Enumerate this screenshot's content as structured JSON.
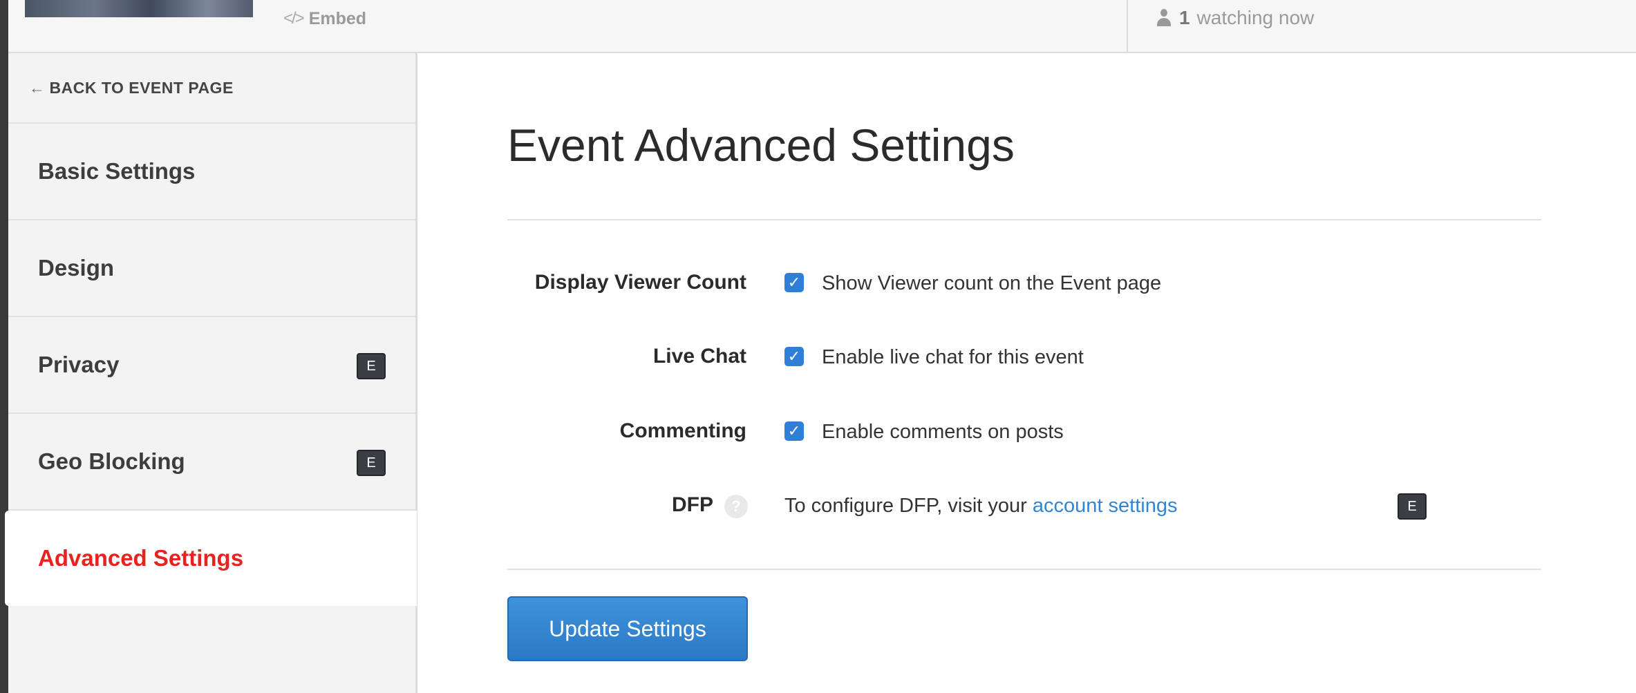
{
  "topbar": {
    "embed_icon": "</>",
    "embed_label": "Embed",
    "viewer_count": "1",
    "viewer_suffix": "watching now"
  },
  "sidebar": {
    "back_arrow": "←",
    "back_label": "BACK TO EVENT PAGE",
    "items": [
      {
        "label": "Basic Settings",
        "badge": ""
      },
      {
        "label": "Design",
        "badge": ""
      },
      {
        "label": "Privacy",
        "badge": "E"
      },
      {
        "label": "Geo Blocking",
        "badge": "E"
      },
      {
        "label": "Advanced Settings",
        "badge": "",
        "active": true
      }
    ]
  },
  "main": {
    "title": "Event Advanced Settings",
    "settings": [
      {
        "label": "Display Viewer Count",
        "checked": true,
        "text": "Show Viewer count on the Event page"
      },
      {
        "label": "Live Chat",
        "checked": true,
        "text": "Enable live chat for this event"
      },
      {
        "label": "Commenting",
        "checked": true,
        "text": "Enable comments on posts"
      }
    ],
    "dfp": {
      "label": "DFP",
      "help": "?",
      "text_prefix": "To configure DFP, visit your",
      "link_text": "account settings",
      "badge": "E"
    },
    "checkmark": "✓",
    "update_button": "Update Settings"
  },
  "colors": {
    "active_nav": "#e8231f",
    "primary_button": "#2f86d6",
    "link": "#2f86d6",
    "checkbox": "#2f7fd6"
  }
}
